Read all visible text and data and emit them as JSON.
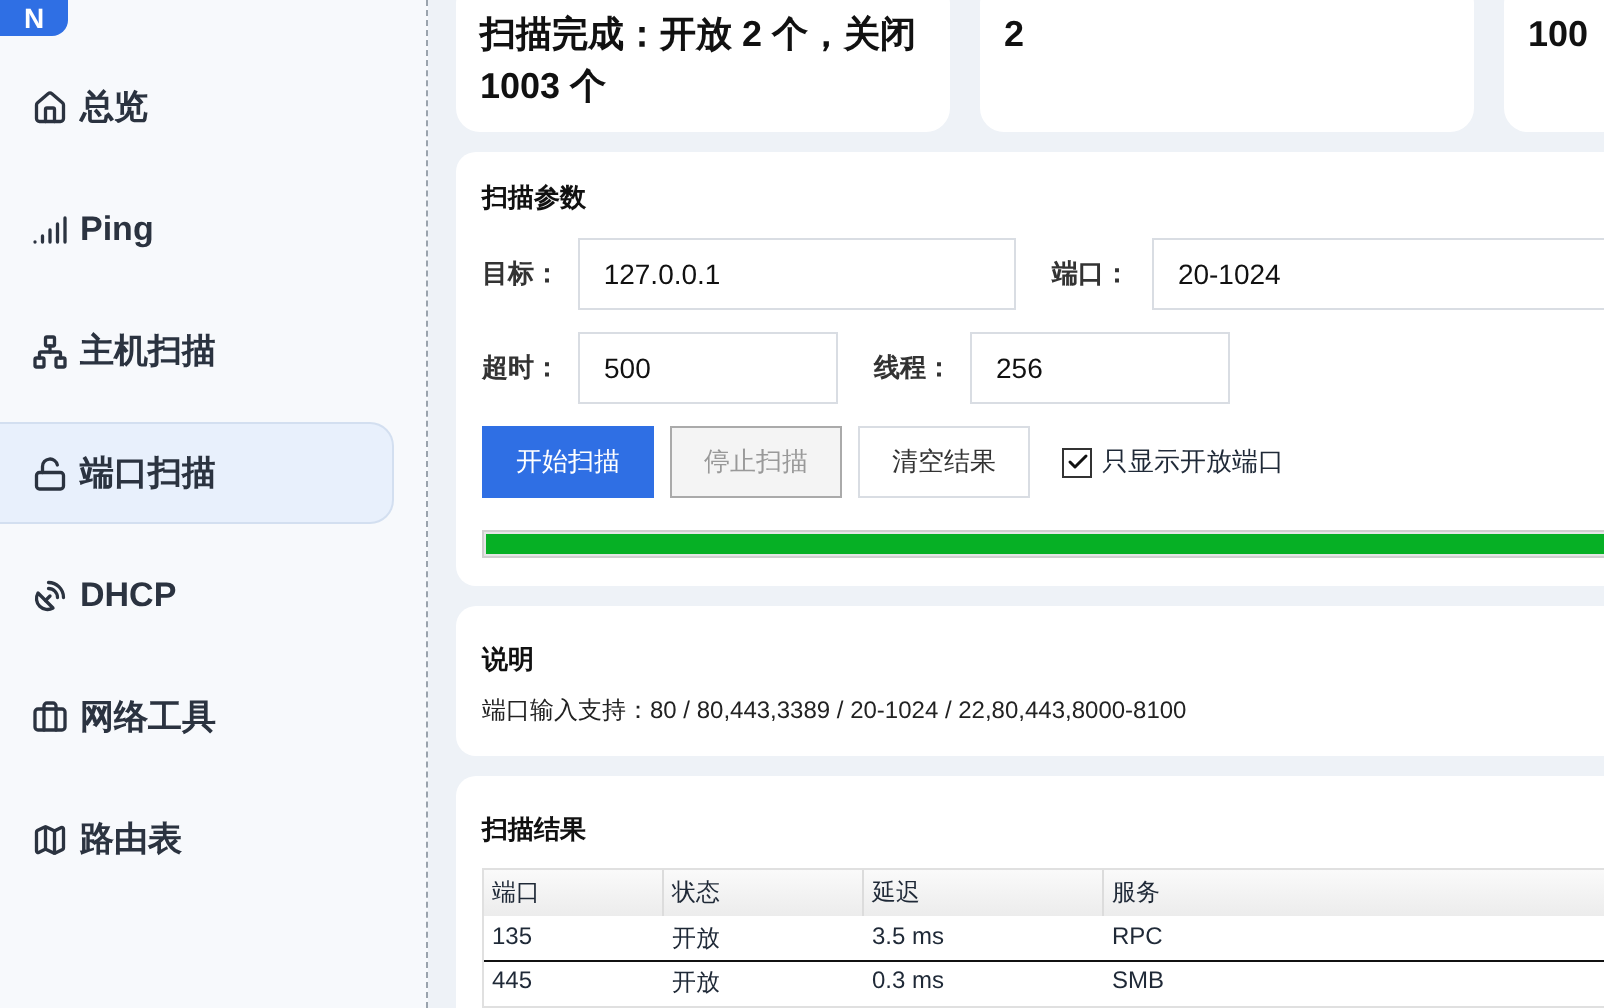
{
  "sidebar": {
    "logo_letter": "N",
    "items": [
      {
        "label": "总览",
        "selected": false
      },
      {
        "label": "Ping",
        "selected": false
      },
      {
        "label": "主机扫描",
        "selected": false
      },
      {
        "label": "端口扫描",
        "selected": true
      },
      {
        "label": "DHCP",
        "selected": false
      },
      {
        "label": "网络工具",
        "selected": false
      },
      {
        "label": "路由表",
        "selected": false
      }
    ]
  },
  "stats": [
    "扫描完成：开放 2 个，关闭 1003 个",
    "2",
    "100"
  ],
  "params": {
    "title": "扫描参数",
    "target": {
      "label": "目标：",
      "value": "127.0.0.1"
    },
    "ports": {
      "label": "端口：",
      "value": "20-1024"
    },
    "timeout": {
      "label": "超时：",
      "value": "500"
    },
    "threads": {
      "label": "线程：",
      "value": "256"
    },
    "buttons": [
      {
        "label": "开始扫描",
        "kind": "primary",
        "disabled": false
      },
      {
        "label": "停止扫描",
        "kind": "default",
        "disabled": true
      },
      {
        "label": "清空结果",
        "kind": "default",
        "disabled": false
      }
    ],
    "only_open": {
      "label": "只显示开放端口",
      "checked": true
    },
    "progress": {
      "level": 1
    }
  },
  "info": {
    "title": "说明",
    "text": "端口输入支持：80 / 80,443,3389 / 20-1024 / 22,80,443,8000-8100"
  },
  "results": {
    "title": "扫描结果",
    "columns": [
      "端口",
      "状态",
      "延迟",
      "服务"
    ],
    "rows": [
      {
        "cells": [
          "135",
          "开放",
          "3.5 ms",
          "RPC"
        ],
        "selected": true
      },
      {
        "cells": [
          "445",
          "开放",
          "0.3 ms",
          "SMB"
        ],
        "selected": false
      }
    ]
  }
}
